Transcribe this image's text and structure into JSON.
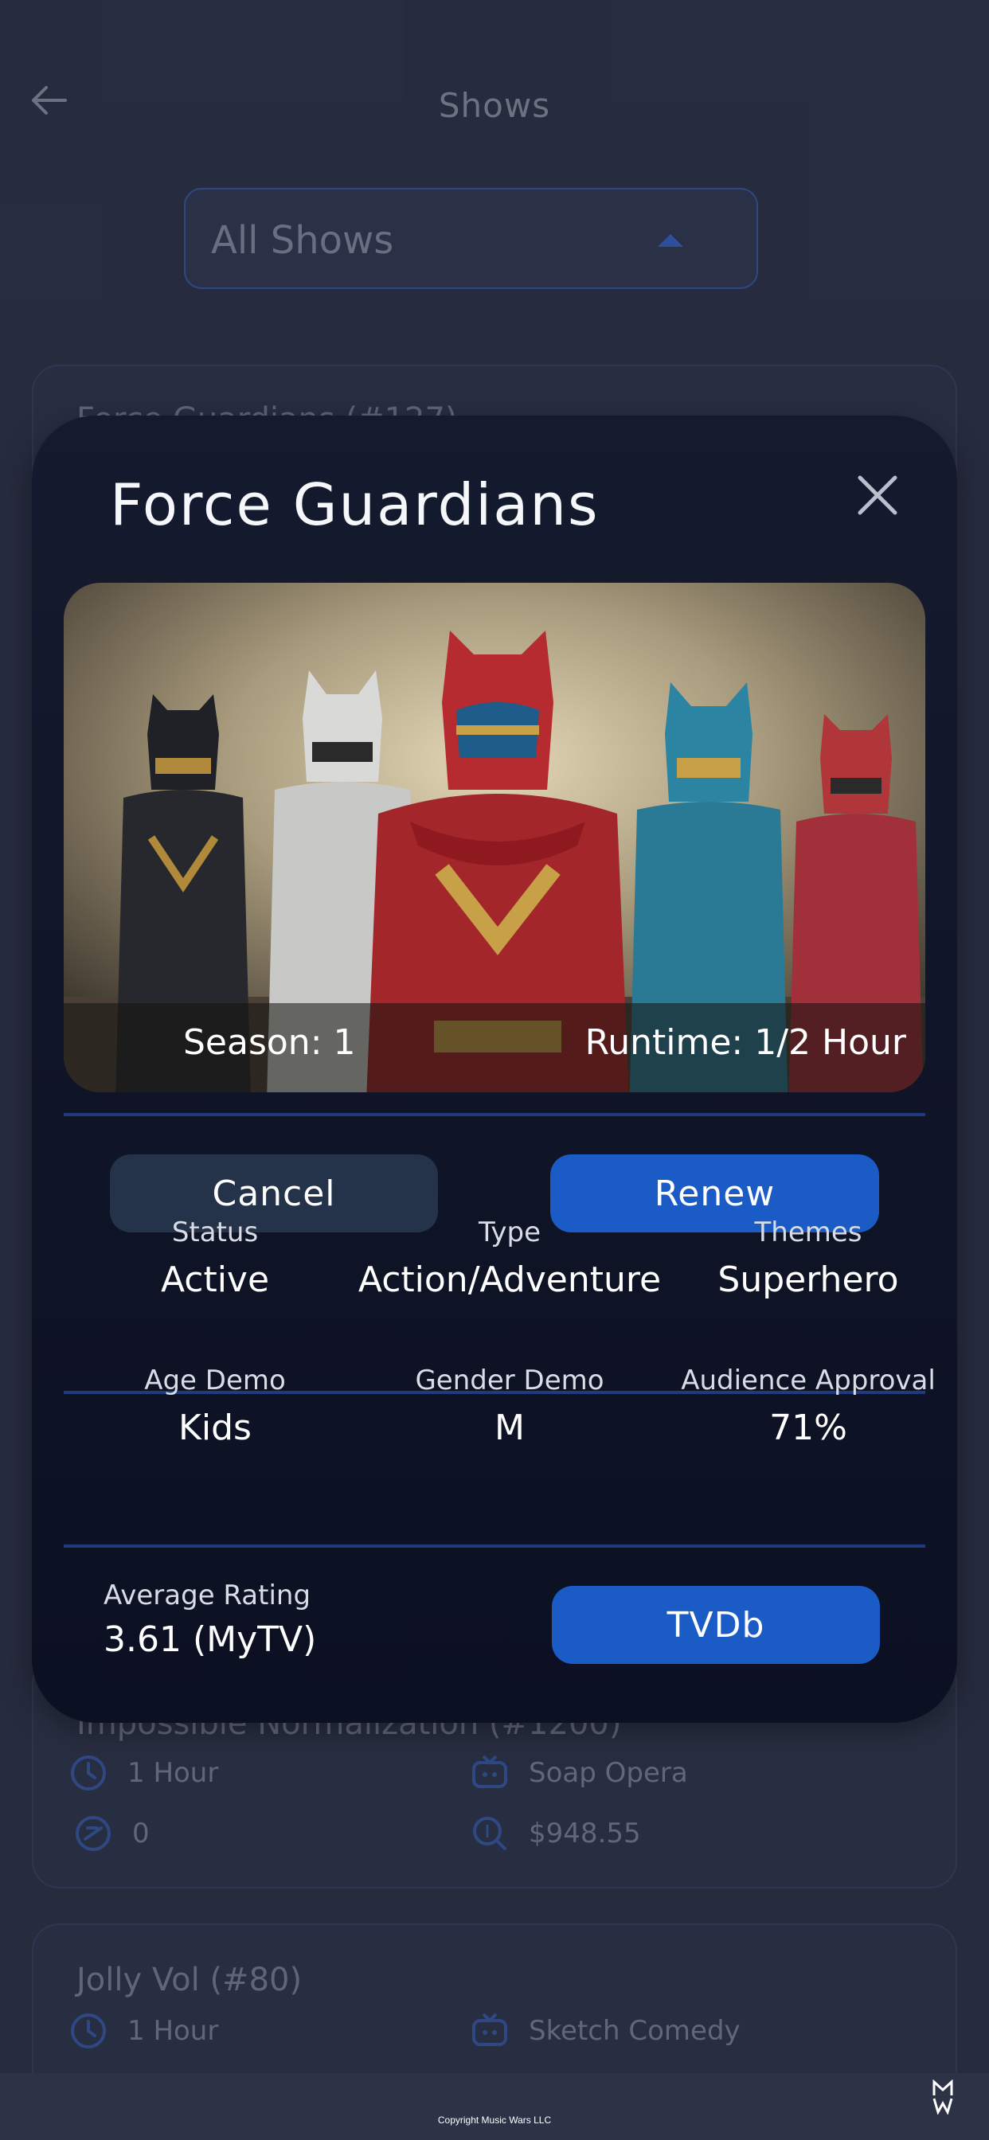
{
  "header": {
    "title": "Shows",
    "back_icon": "arrow-left-icon"
  },
  "filter": {
    "selected": "All Shows"
  },
  "background_cards": [
    {
      "title": "Force Guardians (#127)"
    },
    {
      "title": "Impossible Normalization (#1200)",
      "runtime": "1 Hour",
      "genre": "Soap Opera",
      "rating_count": "0",
      "cost": "$948.55"
    },
    {
      "title": "Jolly Vol (#80)",
      "runtime": "1 Hour",
      "genre": "Sketch Comedy"
    }
  ],
  "modal": {
    "title": "Force Guardians",
    "close_icon": "close-icon",
    "season": "Season: 1",
    "runtime": "Runtime: 1/2 Hour",
    "cancel_label": "Cancel",
    "renew_label": "Renew",
    "stats_row1": [
      {
        "label": "Status",
        "value": "Active"
      },
      {
        "label": "Type",
        "value": "Action/Adventure"
      },
      {
        "label": "Themes",
        "value": "Superhero"
      }
    ],
    "stats_row2": [
      {
        "label": "Age Demo",
        "value": "Kids"
      },
      {
        "label": "Gender Demo",
        "value": "M"
      },
      {
        "label": "Audience Approval",
        "value": "71%"
      }
    ],
    "rating_label": "Average Rating",
    "rating_value": "3.61 (MyTV)",
    "tvdb_label": "TVDb"
  },
  "footer": {
    "copyright": "Copyright Music Wars LLC",
    "logo_text": "MW"
  },
  "colors": {
    "accent": "#1a5bc6",
    "background": "#2d3347",
    "modal": "#11172a",
    "cancel": "#243349",
    "divider": "#1f3a7e"
  }
}
